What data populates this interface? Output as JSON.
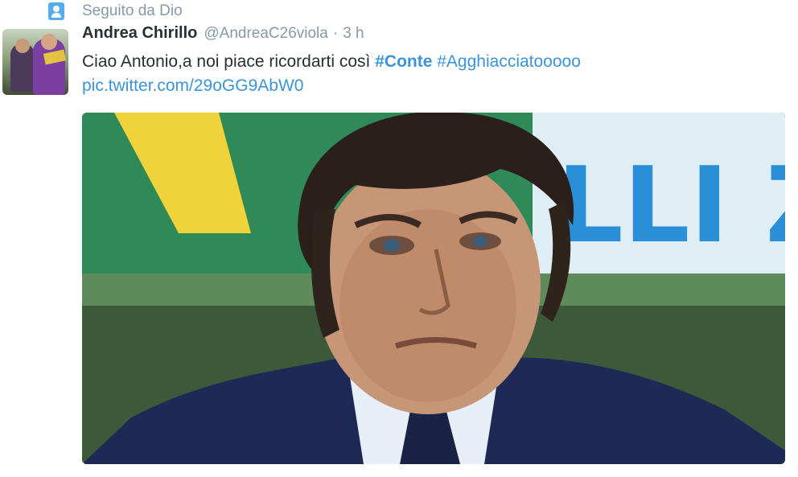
{
  "context": {
    "label": "Seguito da Dio",
    "icon": "person-icon"
  },
  "tweet": {
    "author_name": "Andrea Chirillo",
    "author_handle": "@AndreaC26viola",
    "separator": "·",
    "time": "3 h",
    "text_prefix": "Ciao Antonio,a noi piace ricordarti così",
    "hashtags": [
      "#Conte",
      "#Agghiacciatooooo"
    ],
    "link": "pic.twitter.com/29oGG9AbW0"
  },
  "media": {
    "background_text": "LLI Z"
  },
  "colors": {
    "accent": "#3b94d9",
    "muted": "#8899a6",
    "text": "#292f33"
  }
}
